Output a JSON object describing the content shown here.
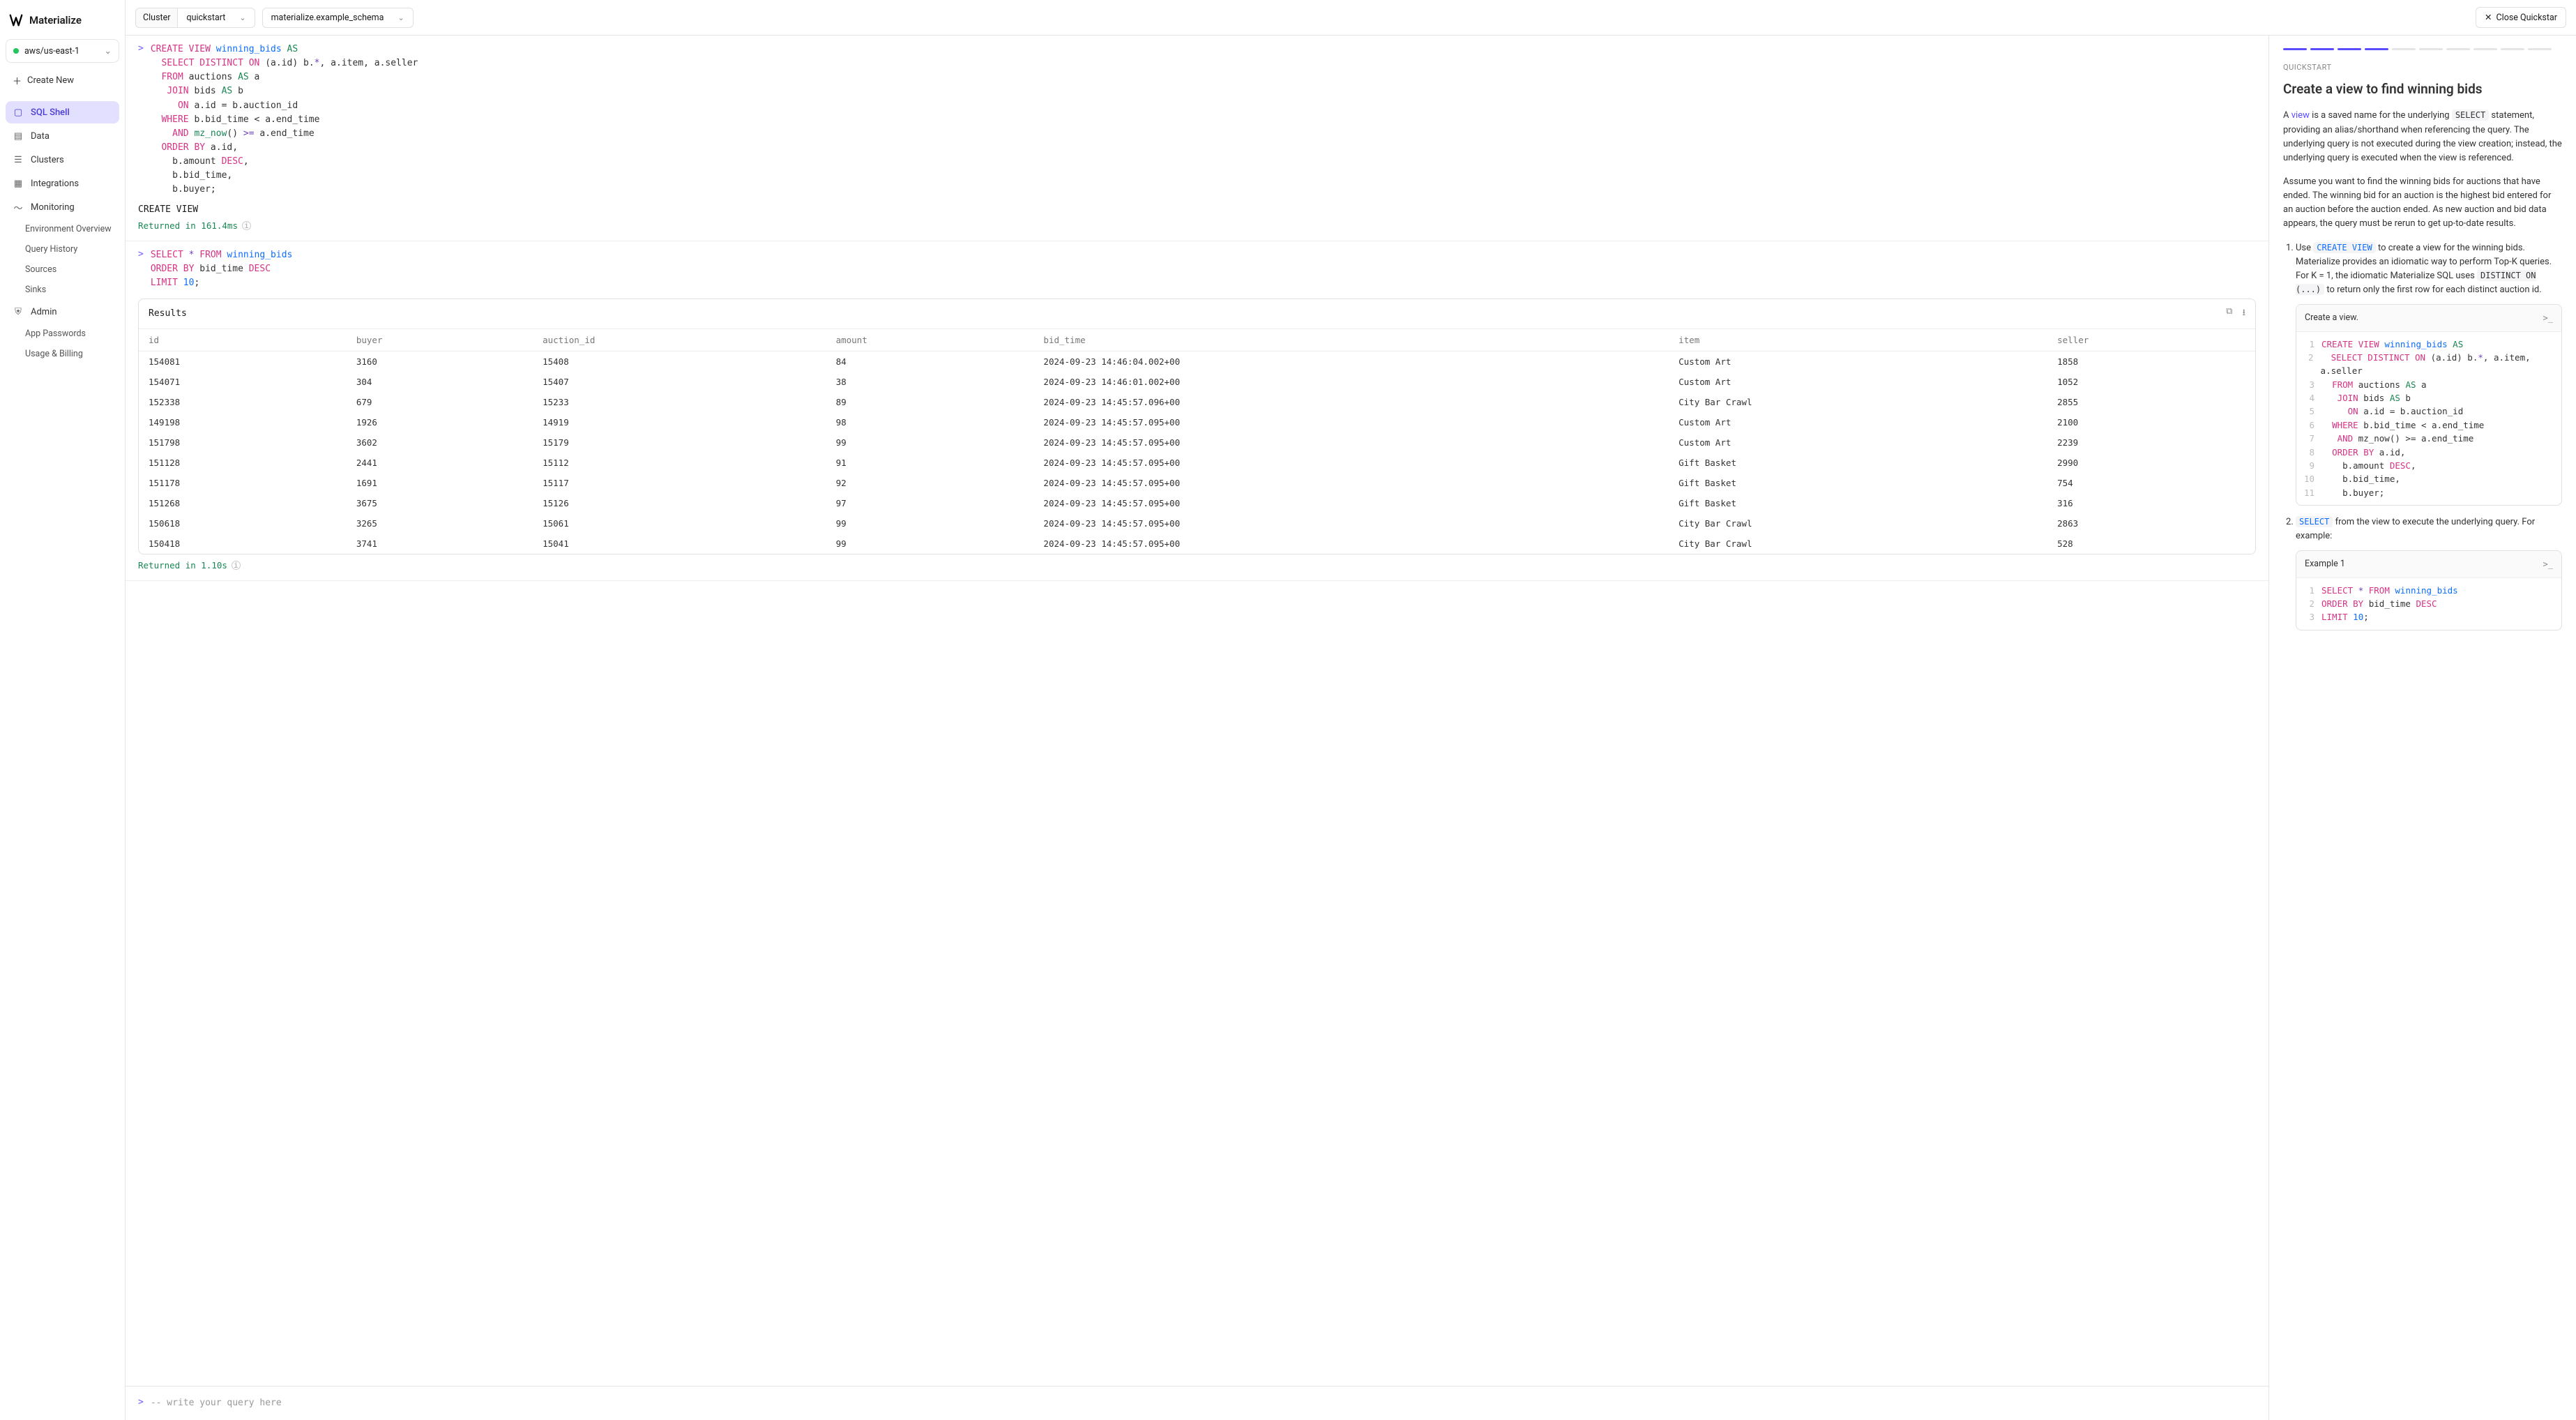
{
  "brand": "Materialize",
  "env": "aws/us-east-1",
  "create_new": "Create New",
  "nav": {
    "sql_shell": "SQL Shell",
    "data": "Data",
    "clusters": "Clusters",
    "integrations": "Integrations",
    "monitoring": "Monitoring",
    "mon_sub": {
      "env_overview": "Environment Overview",
      "query_history": "Query History",
      "sources": "Sources",
      "sinks": "Sinks"
    },
    "admin": "Admin",
    "admin_sub": {
      "app_passwords": "App Passwords",
      "usage_billing": "Usage & Billing"
    }
  },
  "topbar": {
    "cluster_label": "Cluster",
    "cluster_value": "quickstart",
    "schema_value": "materialize.example_schema",
    "close_quickstart": "Close Quickstar"
  },
  "block1": {
    "result_line": "CREATE VIEW",
    "returned": "Returned in 161.4ms"
  },
  "block2": {
    "results_title": "Results",
    "columns": [
      "id",
      "buyer",
      "auction_id",
      "amount",
      "bid_time",
      "item",
      "seller"
    ],
    "rows": [
      [
        "154081",
        "3160",
        "15408",
        "84",
        "2024-09-23 14:46:04.002+00",
        "Custom Art",
        "1858"
      ],
      [
        "154071",
        "304",
        "15407",
        "38",
        "2024-09-23 14:46:01.002+00",
        "Custom Art",
        "1052"
      ],
      [
        "152338",
        "679",
        "15233",
        "89",
        "2024-09-23 14:45:57.096+00",
        "City Bar Crawl",
        "2855"
      ],
      [
        "149198",
        "1926",
        "14919",
        "98",
        "2024-09-23 14:45:57.095+00",
        "Custom Art",
        "2100"
      ],
      [
        "151798",
        "3602",
        "15179",
        "99",
        "2024-09-23 14:45:57.095+00",
        "Custom Art",
        "2239"
      ],
      [
        "151128",
        "2441",
        "15112",
        "91",
        "2024-09-23 14:45:57.095+00",
        "Gift Basket",
        "2990"
      ],
      [
        "151178",
        "1691",
        "15117",
        "92",
        "2024-09-23 14:45:57.095+00",
        "Gift Basket",
        "754"
      ],
      [
        "151268",
        "3675",
        "15126",
        "97",
        "2024-09-23 14:45:57.095+00",
        "Gift Basket",
        "316"
      ],
      [
        "150618",
        "3265",
        "15061",
        "99",
        "2024-09-23 14:45:57.095+00",
        "City Bar Crawl",
        "2863"
      ],
      [
        "150418",
        "3741",
        "15041",
        "99",
        "2024-09-23 14:45:57.095+00",
        "City Bar Crawl",
        "528"
      ]
    ],
    "returned": "Returned in 1.10s"
  },
  "input_placeholder": "-- write your query here",
  "panel": {
    "eyebrow": "QUICKSTART",
    "title": "Create a view to find winning bids",
    "p1_a": "A ",
    "p1_link": "view",
    "p1_b": " is a saved name for the underlying ",
    "p1_code": "SELECT",
    "p1_c": " statement, providing an alias/shorthand when referencing the query. The underlying query is not executed during the view creation; instead, the underlying query is executed when the view is referenced.",
    "p2": "Assume you want to find the winning bids for auctions that have ended. The winning bid for an auction is the highest bid entered for an auction before the auction ended. As new auction and bid data appears, the query must be rerun to get up-to-date results.",
    "step1_a": "Use ",
    "step1_code1": "CREATE VIEW",
    "step1_b": " to create a view for the winning bids. Materialize provides an idiomatic way to perform Top-K queries. For K = 1, the idiomatic Materialize SQL uses ",
    "step1_code2": "DISTINCT ON (...)",
    "step1_c": " to return only the first row for each distinct auction id.",
    "card1_title": "Create a view.",
    "step2_code": "SELECT",
    "step2_a": " from the view to execute the underlying query. For example:",
    "card2_title": "Example 1"
  }
}
